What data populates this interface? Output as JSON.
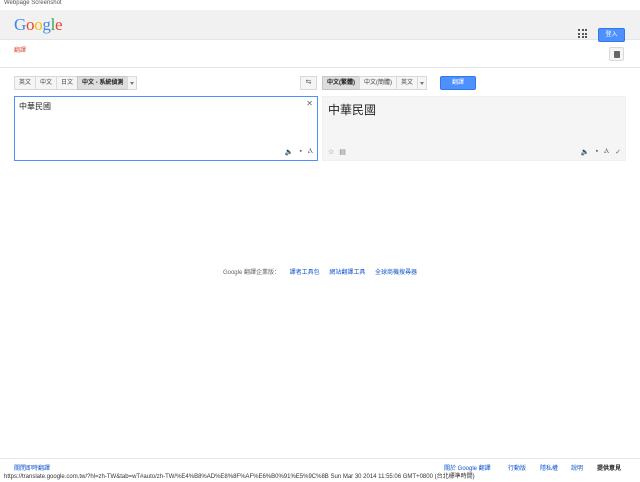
{
  "window": {
    "caption": "Webpage Screenshot"
  },
  "header": {
    "logo": [
      "G",
      "o",
      "o",
      "g",
      "l",
      "e"
    ],
    "signin_label": "登入"
  },
  "subheader": {
    "title": "翻譯"
  },
  "source_langs": {
    "buttons": [
      "英文",
      "中文",
      "日文",
      "中文 - 系統偵測"
    ],
    "active_index": 3
  },
  "target_langs": {
    "buttons": [
      "中文(繁體)",
      "中文(簡體)",
      "英文"
    ],
    "active_index": 0
  },
  "swap_label": "⇆",
  "translate_button": "翻譯",
  "source": {
    "text": "中華民國"
  },
  "result": {
    "text": "中華民國"
  },
  "business": {
    "prefix": "Google 翻譯企業版：",
    "links": [
      "譯者工具包",
      "網站翻譯工具",
      "全球商機搜尋器"
    ]
  },
  "footer": {
    "links": [
      "關閉即時翻譯",
      "關於 Google 翻譯",
      "行動版",
      "隱私權",
      "說明"
    ],
    "feedback": "提供意見"
  },
  "status_url": "https://translate.google.com.tw/?hl=zh-TW&tab=wT#auto/zh-TW/%E4%B8%AD%E8%8F%AF%E6%B0%91%E5%9C%8B Sun Mar 30 2014 11:55:06 GMT+0800 (台北標準時間)",
  "colors": {
    "accent": "#4d90fe",
    "link": "#1155cc",
    "title_red": "#dd4b39"
  }
}
